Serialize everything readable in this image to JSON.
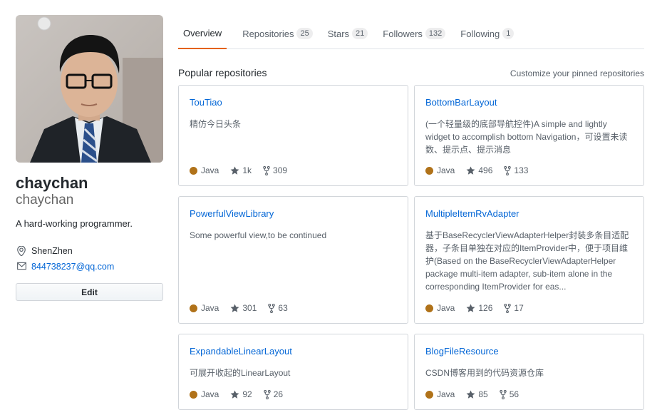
{
  "profile": {
    "fullname": "chaychan",
    "login": "chaychan",
    "bio": "A hard-working programmer.",
    "location": "ShenZhen",
    "email": "844738237@qq.com",
    "edit_label": "Edit"
  },
  "tabs": [
    {
      "label": "Overview",
      "count": null,
      "selected": true
    },
    {
      "label": "Repositories",
      "count": "25"
    },
    {
      "label": "Stars",
      "count": "21"
    },
    {
      "label": "Followers",
      "count": "132"
    },
    {
      "label": "Following",
      "count": "1"
    }
  ],
  "pinned": {
    "title": "Popular repositories",
    "customize_label": "Customize your pinned repositories",
    "repos": [
      {
        "name": "TouTiao",
        "description": "精仿今日头条",
        "language": "Java",
        "stars": "1k",
        "forks": "309"
      },
      {
        "name": "BottomBarLayout",
        "description": "(一个轻量级的底部导航控件)A simple and lightly widget to accomplish bottom Navigation，可设置未读数、提示点、提示消息",
        "language": "Java",
        "stars": "496",
        "forks": "133"
      },
      {
        "name": "PowerfulViewLibrary",
        "description": "Some powerful view,to be continued",
        "language": "Java",
        "stars": "301",
        "forks": "63"
      },
      {
        "name": "MultipleItemRvAdapter",
        "description": "基于BaseRecyclerViewAdapterHelper封装多条目适配器，子条目单独在对应的ItemProvider中，便于项目维护(Based on the BaseRecyclerViewAdapterHelper package multi-item adapter, sub-item alone in the corresponding ItemProvider for eas...",
        "language": "Java",
        "stars": "126",
        "forks": "17"
      },
      {
        "name": "ExpandableLinearLayout",
        "description": "可展开收起的LinearLayout",
        "language": "Java",
        "stars": "92",
        "forks": "26"
      },
      {
        "name": "BlogFileResource",
        "description": "CSDN博客用到的代码资源仓库",
        "language": "Java",
        "stars": "85",
        "forks": "56"
      }
    ]
  },
  "colors": {
    "link": "#0366d6",
    "java": "#b07219",
    "tab_underline": "#e36209"
  }
}
